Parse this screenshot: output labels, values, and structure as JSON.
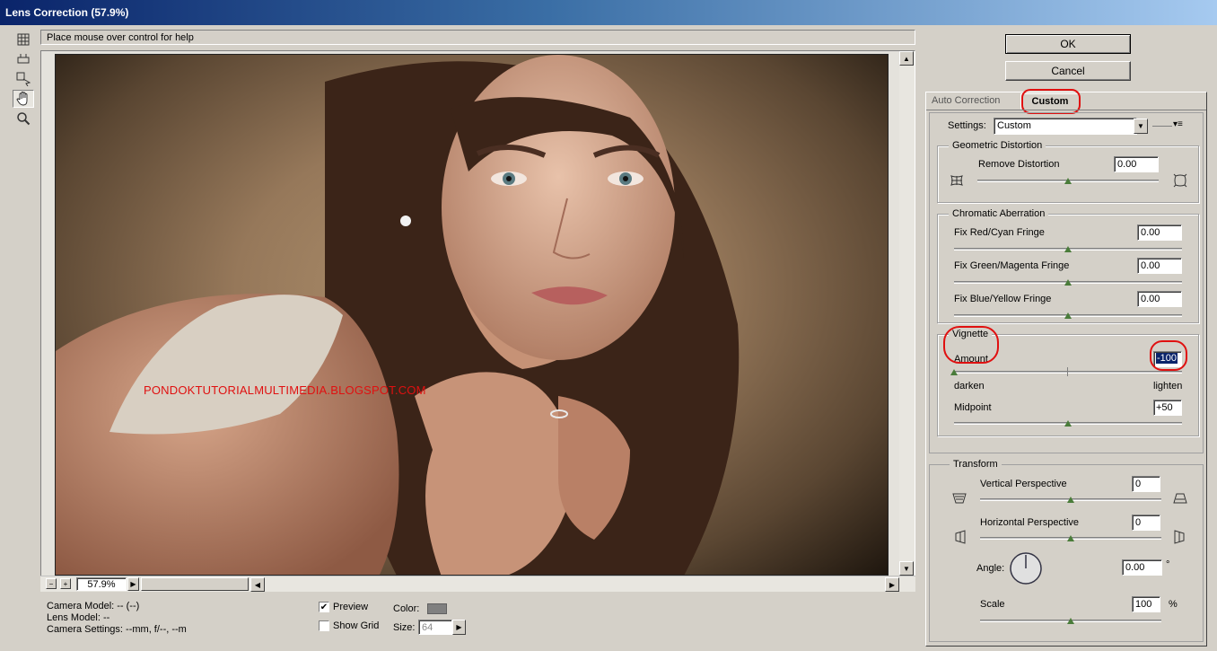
{
  "window": {
    "title": "Lens Correction (57.9%)"
  },
  "help_text": "Place mouse over control for help",
  "buttons": {
    "ok": "OK",
    "cancel": "Cancel"
  },
  "tabs": {
    "auto": "Auto Correction",
    "custom": "Custom"
  },
  "settings": {
    "label": "Settings:",
    "value": "Custom"
  },
  "geometric": {
    "title": "Geometric Distortion",
    "remove_label": "Remove Distortion",
    "remove_value": "0.00",
    "remove_level": 0.5
  },
  "chromatic": {
    "title": "Chromatic Aberration",
    "items": [
      {
        "label": "Fix Red/Cyan Fringe",
        "value": "0.00",
        "level": 0.5
      },
      {
        "label": "Fix Green/Magenta Fringe",
        "value": "0.00",
        "level": 0.5
      },
      {
        "label": "Fix Blue/Yellow Fringe",
        "value": "0.00",
        "level": 0.5
      }
    ]
  },
  "vignette": {
    "title": "Vignette",
    "amount_label": "Amount",
    "amount_value": "-100",
    "amount_level": 0.0,
    "darken": "darken",
    "lighten": "lighten",
    "midpoint_label": "Midpoint",
    "midpoint_value": "+50",
    "midpoint_level": 0.5
  },
  "transform": {
    "title": "Transform",
    "vertical_label": "Vertical Perspective",
    "vertical_value": "0",
    "vertical_level": 0.5,
    "horizontal_label": "Horizontal Perspective",
    "horizontal_value": "0",
    "horizontal_level": 0.5,
    "angle_label": "Angle:",
    "angle_value": "0.00",
    "angle_unit": "°",
    "scale_label": "Scale",
    "scale_value": "100",
    "scale_unit": "%",
    "scale_level": 0.5
  },
  "zoom": {
    "value": "57.9%",
    "minus": "−",
    "plus": "+"
  },
  "camera": {
    "model": "Camera Model: -- (--)",
    "lens": "Lens Model: --",
    "settings": "Camera Settings: --mm, f/--, --m"
  },
  "preview": {
    "label": "Preview",
    "checked": true
  },
  "show_grid": {
    "label": "Show Grid",
    "checked": false
  },
  "grid_color": {
    "label": "Color:",
    "value": "#808080"
  },
  "grid_size": {
    "label": "Size:",
    "value": "64"
  },
  "watermark": "PONDOKTUTORIALMULTIMEDIA.BLOGSPOT.COM",
  "colors": {
    "title_start": "#0a246a",
    "dialog_bg": "#d4d0c8",
    "annotation": "#e01010",
    "slider_thumb": "#4a7c3a"
  }
}
